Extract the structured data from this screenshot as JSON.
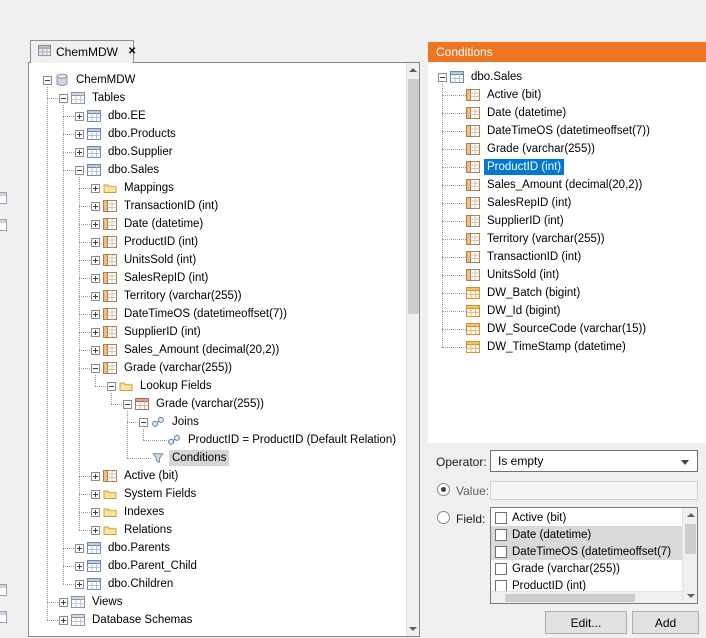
{
  "tab": {
    "title": "ChemMDW",
    "close_icon": "✕"
  },
  "left_tree": {
    "items": [
      {
        "label": "ChemMDW",
        "level": 0,
        "exp": "minus",
        "icon": "db"
      },
      {
        "label": "Tables",
        "level": 1,
        "exp": "minus",
        "icon": "tables"
      },
      {
        "label": "dbo.EE",
        "level": 2,
        "exp": "plus",
        "icon": "table"
      },
      {
        "label": "dbo.Products",
        "level": 2,
        "exp": "plus",
        "icon": "table"
      },
      {
        "label": "dbo.Supplier",
        "level": 2,
        "exp": "plus",
        "icon": "table"
      },
      {
        "label": "dbo.Sales",
        "level": 2,
        "exp": "minus",
        "icon": "table"
      },
      {
        "label": "Mappings",
        "level": 3,
        "exp": "plus",
        "icon": "folder"
      },
      {
        "label": "TransactionID (int)",
        "level": 3,
        "exp": "plus",
        "icon": "field"
      },
      {
        "label": "Date (datetime)",
        "level": 3,
        "exp": "plus",
        "icon": "field"
      },
      {
        "label": "ProductID (int)",
        "level": 3,
        "exp": "plus",
        "icon": "field"
      },
      {
        "label": "UnitsSold (int)",
        "level": 3,
        "exp": "plus",
        "icon": "field"
      },
      {
        "label": "SalesRepID (int)",
        "level": 3,
        "exp": "plus",
        "icon": "field"
      },
      {
        "label": "Territory (varchar(255))",
        "level": 3,
        "exp": "plus",
        "icon": "field"
      },
      {
        "label": "DateTimeOS (datetimeoffset(7))",
        "level": 3,
        "exp": "plus",
        "icon": "field"
      },
      {
        "label": "SupplierID (int)",
        "level": 3,
        "exp": "plus",
        "icon": "field"
      },
      {
        "label": "Sales_Amount (decimal(20,2))",
        "level": 3,
        "exp": "plus",
        "icon": "field"
      },
      {
        "label": "Grade (varchar(255))",
        "level": 3,
        "exp": "minus",
        "icon": "field"
      },
      {
        "label": "Lookup Fields",
        "level": 4,
        "exp": "minus",
        "icon": "folder"
      },
      {
        "label": "Grade (varchar(255))",
        "level": 5,
        "exp": "minus",
        "icon": "lookup"
      },
      {
        "label": "Joins",
        "level": 6,
        "exp": "minus",
        "icon": "joins"
      },
      {
        "label": "ProductID = ProductID (Default Relation)",
        "level": 7,
        "exp": "",
        "icon": "join"
      },
      {
        "label": "Conditions",
        "level": 6,
        "exp": "",
        "icon": "funnel",
        "selected": "inactive"
      },
      {
        "label": "Active (bit)",
        "level": 3,
        "exp": "plus",
        "icon": "field"
      },
      {
        "label": "System Fields",
        "level": 3,
        "exp": "plus",
        "icon": "folder"
      },
      {
        "label": "Indexes",
        "level": 3,
        "exp": "plus",
        "icon": "folder"
      },
      {
        "label": "Relations",
        "level": 3,
        "exp": "plus",
        "icon": "folder"
      },
      {
        "label": "dbo.Parents",
        "level": 2,
        "exp": "plus",
        "icon": "table"
      },
      {
        "label": "dbo.Parent_Child",
        "level": 2,
        "exp": "plus",
        "icon": "table"
      },
      {
        "label": "dbo.Children",
        "level": 2,
        "exp": "plus",
        "icon": "table"
      },
      {
        "label": "Views",
        "level": 1,
        "exp": "plus",
        "icon": "views"
      },
      {
        "label": "Database Schemas",
        "level": 1,
        "exp": "plus",
        "icon": "tables"
      }
    ]
  },
  "right_panel": {
    "header": "Conditions",
    "tree": {
      "items": [
        {
          "label": "dbo.Sales",
          "level": 0,
          "exp": "minus",
          "icon": "table"
        },
        {
          "label": "Active (bit)",
          "level": 1,
          "exp": "",
          "icon": "field"
        },
        {
          "label": "Date (datetime)",
          "level": 1,
          "exp": "",
          "icon": "field"
        },
        {
          "label": "DateTimeOS (datetimeoffset(7))",
          "level": 1,
          "exp": "",
          "icon": "field"
        },
        {
          "label": "Grade (varchar(255))",
          "level": 1,
          "exp": "",
          "icon": "field"
        },
        {
          "label": "ProductID (int)",
          "level": 1,
          "exp": "",
          "icon": "field",
          "selected": "active"
        },
        {
          "label": "Sales_Amount (decimal(20,2))",
          "level": 1,
          "exp": "",
          "icon": "field"
        },
        {
          "label": "SalesRepID (int)",
          "level": 1,
          "exp": "",
          "icon": "field"
        },
        {
          "label": "SupplierID (int)",
          "level": 1,
          "exp": "",
          "icon": "field"
        },
        {
          "label": "Territory (varchar(255))",
          "level": 1,
          "exp": "",
          "icon": "field"
        },
        {
          "label": "TransactionID (int)",
          "level": 1,
          "exp": "",
          "icon": "field"
        },
        {
          "label": "UnitsSold (int)",
          "level": 1,
          "exp": "",
          "icon": "field"
        },
        {
          "label": "DW_Batch (bigint)",
          "level": 1,
          "exp": "",
          "icon": "dwfield"
        },
        {
          "label": "DW_Id (bigint)",
          "level": 1,
          "exp": "",
          "icon": "dwfield"
        },
        {
          "label": "DW_SourceCode (varchar(15))",
          "level": 1,
          "exp": "",
          "icon": "dwfield"
        },
        {
          "label": "DW_TimeStamp (datetime)",
          "level": 1,
          "exp": "",
          "icon": "dwfield"
        }
      ]
    },
    "form": {
      "operator_label": "Operator:",
      "operator_value": "Is empty",
      "value_label": "Value:",
      "value_text": "",
      "field_label": "Field:",
      "field_options": [
        {
          "label": "Active (bit)",
          "checked": false,
          "highlighted": false
        },
        {
          "label": "Date (datetime)",
          "checked": false,
          "highlighted": true
        },
        {
          "label": "DateTimeOS (datetimeoffset(7)",
          "checked": false,
          "highlighted": true
        },
        {
          "label": "Grade (varchar(255))",
          "checked": false,
          "highlighted": false
        },
        {
          "label": "ProductID (int)",
          "checked": false,
          "highlighted": false
        }
      ],
      "edit_button": "Edit...",
      "add_button": "Add"
    }
  },
  "colors": {
    "accent_orange": "#ee7623",
    "selection_blue": "#0078d7",
    "inactive_selection": "#d5d5d5"
  }
}
